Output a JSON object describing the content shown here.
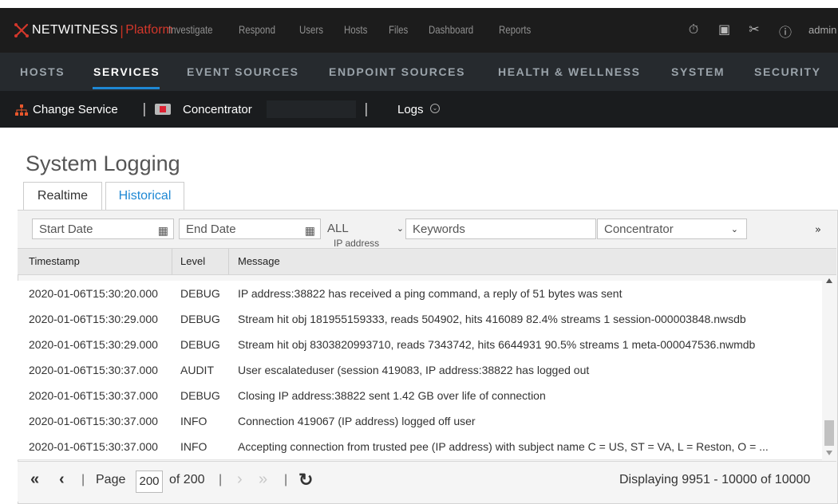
{
  "topbar": {
    "logo_word": "NETWITNESS",
    "logo_sep": "|",
    "logo_platform": "Platform",
    "nav": [
      "Investigate",
      "Respond",
      "Users",
      "Hosts",
      "Files",
      "Dashboard",
      "Reports"
    ],
    "icons": [
      "timer-icon",
      "clipboard-icon",
      "tools-icon",
      "help-icon"
    ],
    "user": "admin ›"
  },
  "secnav": {
    "tabs": [
      "HOSTS",
      "SERVICES",
      "EVENT SOURCES",
      "ENDPOINT SOURCES",
      "HEALTH & WELLNESS",
      "SYSTEM",
      "SECURITY"
    ],
    "active": "SERVICES"
  },
  "servicebar": {
    "change_service": "Change Service",
    "service_name": "Concentrator",
    "view": "Logs"
  },
  "page": {
    "title": "System Logging",
    "tabs": [
      "Realtime",
      "Historical"
    ],
    "active_tab": "Historical"
  },
  "filters": {
    "start_date_placeholder": "Start Date",
    "end_date_placeholder": "End Date",
    "level_value": "ALL",
    "level_sub": "IP address",
    "keywords_placeholder": "Keywords",
    "service_value": "Concentrator",
    "expand": "»"
  },
  "table": {
    "columns": [
      "Timestamp",
      "Level",
      "Message"
    ],
    "rows": [
      {
        "ts": "2020-01-06T15:30:20.000",
        "level": "DEBUG",
        "msg": " IP address:38822      has received a ping command, a reply of 51 bytes was sent"
      },
      {
        "ts": "2020-01-06T15:30:29.000",
        "level": "DEBUG",
        "msg": "Stream hit obj 181955159333, reads 504902, hits 416089 82.4% streams 1 session-000003848.nwsdb"
      },
      {
        "ts": "2020-01-06T15:30:29.000",
        "level": "DEBUG",
        "msg": "Stream hit obj 8303820993710, reads 7343742, hits 6644931 90.5% streams 1 meta-000047536.nwmdb"
      },
      {
        "ts": "2020-01-06T15:30:37.000",
        "level": "AUDIT",
        "msg": "User escalateduser (session 419083,  IP address:38822       has logged out"
      },
      {
        "ts": "2020-01-06T15:30:37.000",
        "level": "DEBUG",
        "msg": "Closing  IP address:38822      sent 1.42 GB over life of connection"
      },
      {
        "ts": "2020-01-06T15:30:37.000",
        "level": "INFO",
        "msg": "Connection 419067  (IP address)      logged off user"
      },
      {
        "ts": "2020-01-06T15:30:37.000",
        "level": "INFO",
        "msg": "Accepting connection from trusted pee  (IP address)      with subject name C = US, ST = VA, L = Reston, O = ..."
      }
    ]
  },
  "pager": {
    "first": "«",
    "prev": "‹",
    "page_label": "Page",
    "page_value": "200",
    "of_label": "of 200",
    "next": "›",
    "last": "»",
    "refresh": "↻",
    "display": "Displaying 9951 - 10000 of 10000"
  }
}
